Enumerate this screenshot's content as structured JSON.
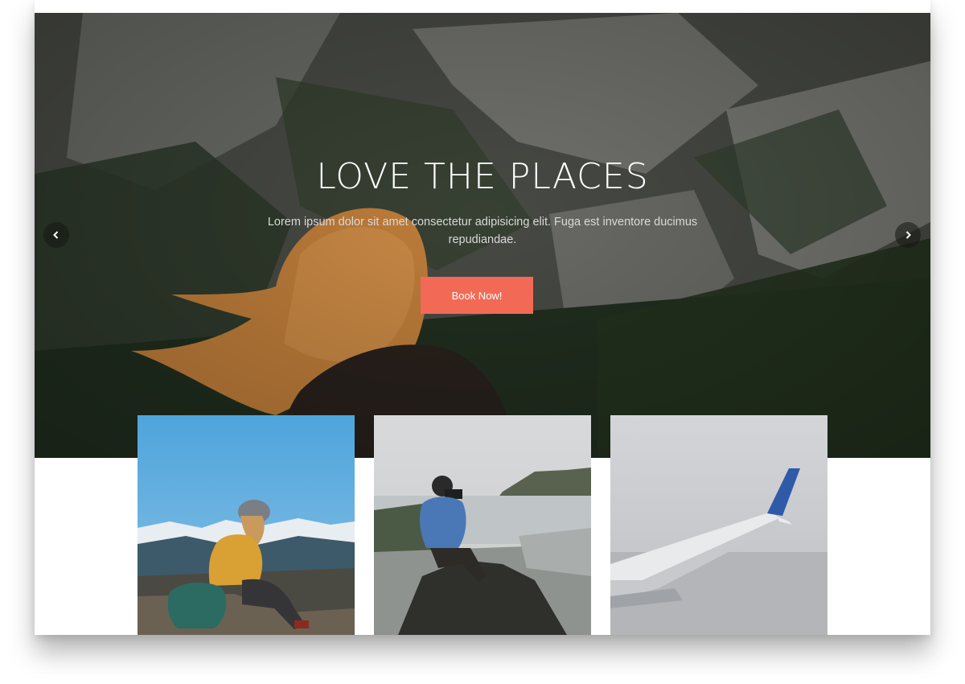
{
  "hero": {
    "title": "LOVE THE PLACES",
    "subtitle": "Lorem ipsum dolor sit amet consectetur adipisicing elit. Fuga est inventore ducimus repudiandae.",
    "button_label": "Book Now!",
    "prev_icon": "chevron-left-icon",
    "next_icon": "chevron-right-icon"
  },
  "colors": {
    "accent": "#f26a56",
    "title_text": "#ffffff",
    "subtitle_text": "#d9d9d9"
  },
  "cards": [
    {
      "image": "hiker-woman-mountains"
    },
    {
      "image": "photographer-on-rock"
    },
    {
      "image": "airplane-wing-clouds"
    }
  ]
}
